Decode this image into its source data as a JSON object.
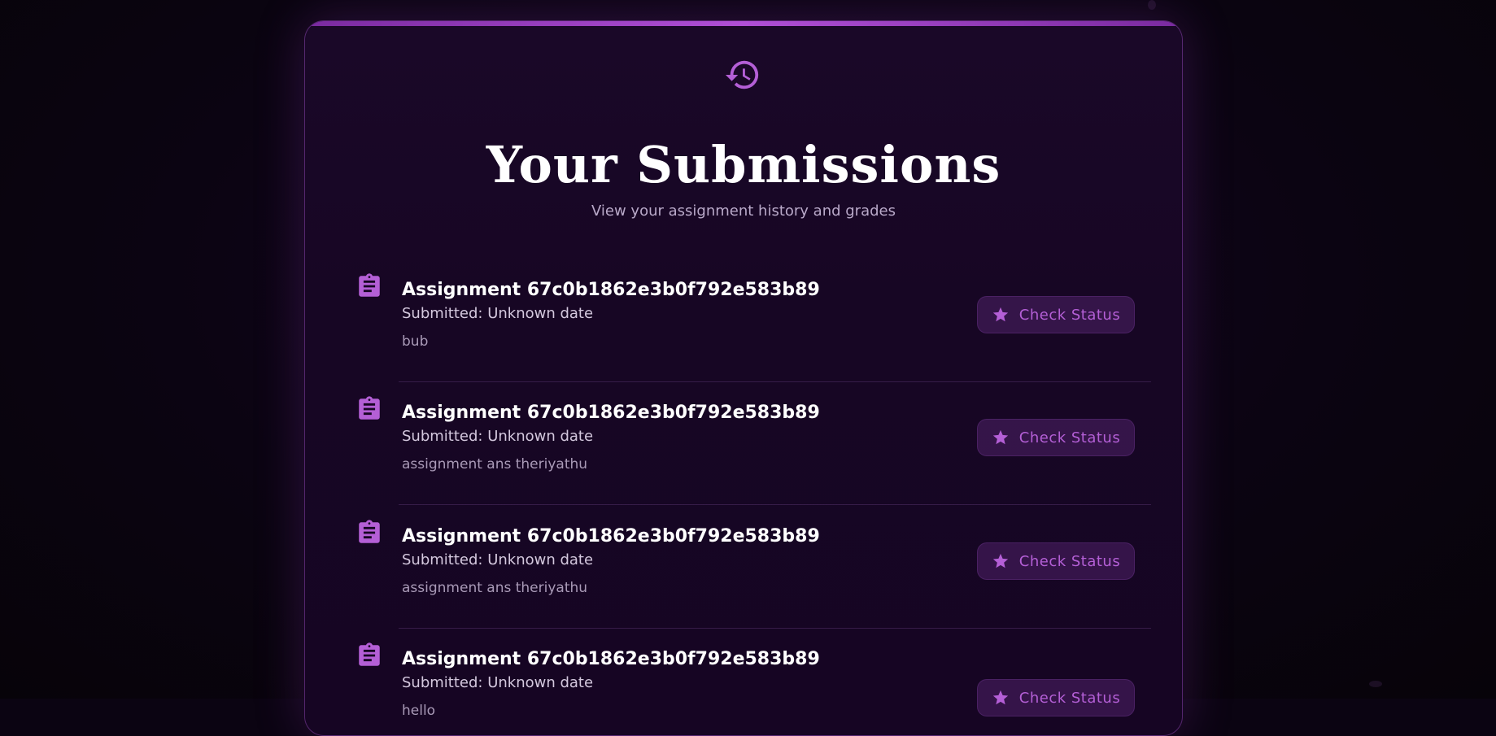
{
  "header": {
    "icon": "history-icon",
    "title": "Your Submissions",
    "subtitle": "View your assignment history and grades"
  },
  "colors": {
    "accent": "#b45fd6",
    "background": "#0b0412",
    "card": "#170624"
  },
  "submissions": [
    {
      "icon": "clipboard-icon",
      "title": "Assignment 67c0b1862e3b0f792e583b89",
      "submitted": "Submitted: Unknown date",
      "note": "bub",
      "button_icon": "star-icon",
      "button_label": "Check Status"
    },
    {
      "icon": "clipboard-icon",
      "title": "Assignment 67c0b1862e3b0f792e583b89",
      "submitted": "Submitted: Unknown date",
      "note": "assignment ans theriyathu",
      "button_icon": "star-icon",
      "button_label": "Check Status"
    },
    {
      "icon": "clipboard-icon",
      "title": "Assignment 67c0b1862e3b0f792e583b89",
      "submitted": "Submitted: Unknown date",
      "note": "assignment ans theriyathu",
      "button_icon": "star-icon",
      "button_label": "Check Status"
    },
    {
      "icon": "clipboard-icon",
      "title": "Assignment 67c0b1862e3b0f792e583b89",
      "submitted": "Submitted: Unknown date",
      "note": "hello",
      "button_icon": "star-icon",
      "button_label": "Check Status"
    }
  ]
}
